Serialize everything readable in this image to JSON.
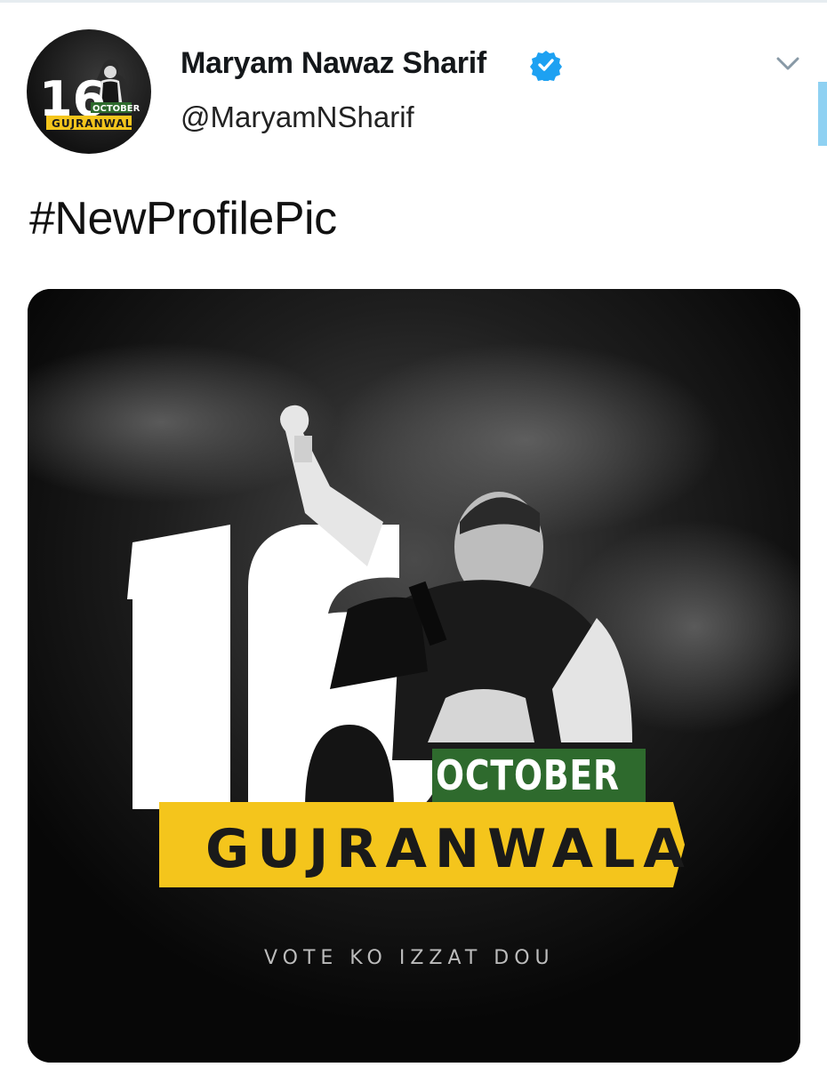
{
  "tweet": {
    "author_name": "Maryam Nawaz Sharif",
    "handle": "@MaryamNSharif",
    "verified": true,
    "text": "#NewProfilePic"
  },
  "icons": {
    "verified": "verified-badge-icon",
    "menu": "chevron-down-icon"
  },
  "avatar_graphic": {
    "number": "16",
    "month": "OCTOBER",
    "city": "GUJRANWALA"
  },
  "media": {
    "number": "16",
    "month": "OCTOBER",
    "city": "GUJRANWALA",
    "slogan": "VOTE KO IZZAT DOU"
  },
  "colors": {
    "verified_blue": "#1da1f2",
    "banner_yellow": "#f4c51c",
    "october_green": "#2e6a2d",
    "media_background": "#0b0b0b"
  }
}
